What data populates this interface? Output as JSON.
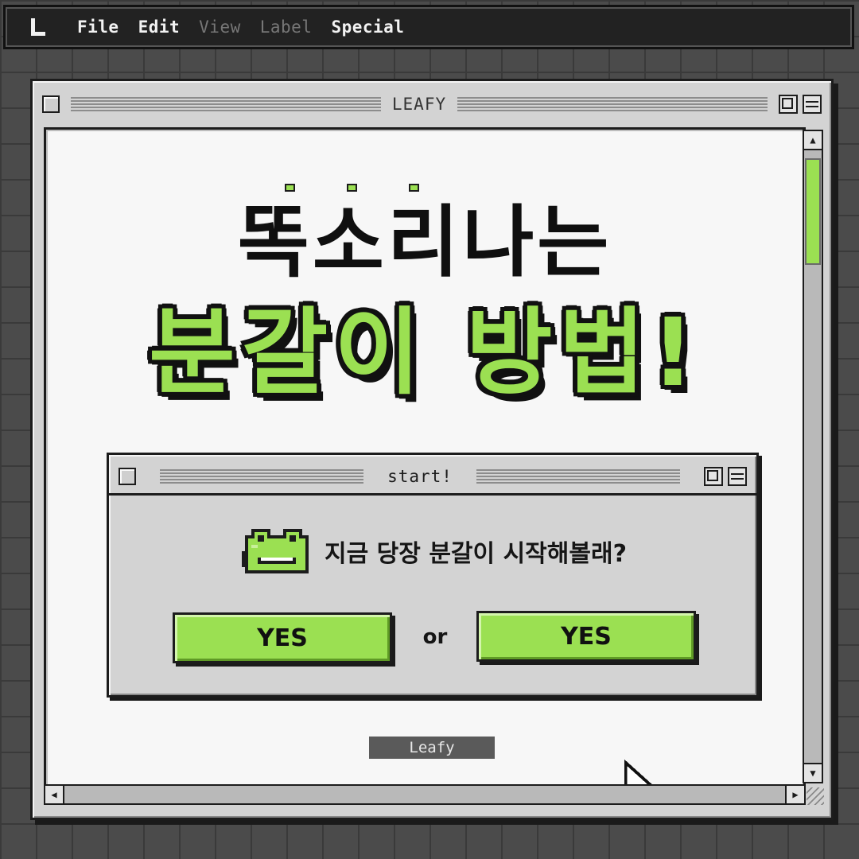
{
  "menubar": {
    "logo": "leafy-logo-icon",
    "items": [
      {
        "label": "File",
        "enabled": true
      },
      {
        "label": "Edit",
        "enabled": true
      },
      {
        "label": "View",
        "enabled": false
      },
      {
        "label": "Label",
        "enabled": false
      },
      {
        "label": "Special",
        "enabled": true
      }
    ]
  },
  "window": {
    "title": "LEAFY",
    "headline_line1": "똑소리나는",
    "headline_line2": "분갈이 방법!",
    "dialog": {
      "title": "start!",
      "icon": "frog-icon",
      "question": "지금 당장 분갈이 시작해볼래?",
      "button_left": "YES",
      "or_text": "or",
      "button_right": "YES"
    },
    "footer_label": "Leafy"
  },
  "colors": {
    "accent": "#9be052",
    "background": "#4b4b4b",
    "window": "#d3d3d3",
    "content": "#f7f7f7",
    "ink": "#1c1c1c"
  }
}
